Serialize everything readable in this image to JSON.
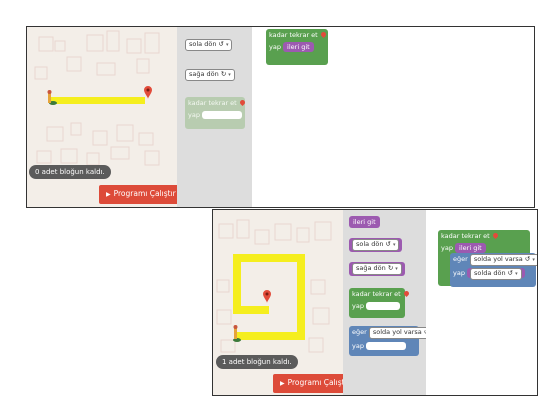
{
  "panel1": {
    "status": "0 adet bloğun kaldı.",
    "run_button": "Programı Çalıştır",
    "toolbox": {
      "turn_left": "sola dön ↺",
      "turn_right": "sağa dön ↻",
      "repeat_until": "kadar tekrar et",
      "do": "yap"
    },
    "workspace": {
      "repeat_until": "kadar tekrar et",
      "do": "yap",
      "move_forward": "ileri git"
    }
  },
  "panel2": {
    "status": "1 adet bloğun kaldı.",
    "run_button": "Programı Çalıştır",
    "toolbox": {
      "move_forward": "ileri git",
      "turn_left": "sola dön ↺",
      "turn_right": "sağa dön ↻",
      "repeat_until": "kadar tekrar et",
      "do": "yap",
      "if": "eğer",
      "path_left": "solda yol varsa ↺",
      "do2": "yap"
    },
    "workspace": {
      "repeat_until": "kadar tekrar et",
      "do": "yap",
      "move_forward": "ileri git",
      "if": "eğer",
      "path_left": "solda yol varsa ↺",
      "do2": "yap",
      "turn_left": "solda dön ↺"
    }
  },
  "colors": {
    "path": "#f5ee1e",
    "loop": "#59a04f",
    "condition": "#5f86b8",
    "action": "#9c5ab0",
    "run": "#dd4b39",
    "marker": "#e24b3a"
  },
  "icons": [
    "map-pin-icon",
    "pegman-icon",
    "play-icon",
    "dropdown-caret-icon"
  ]
}
